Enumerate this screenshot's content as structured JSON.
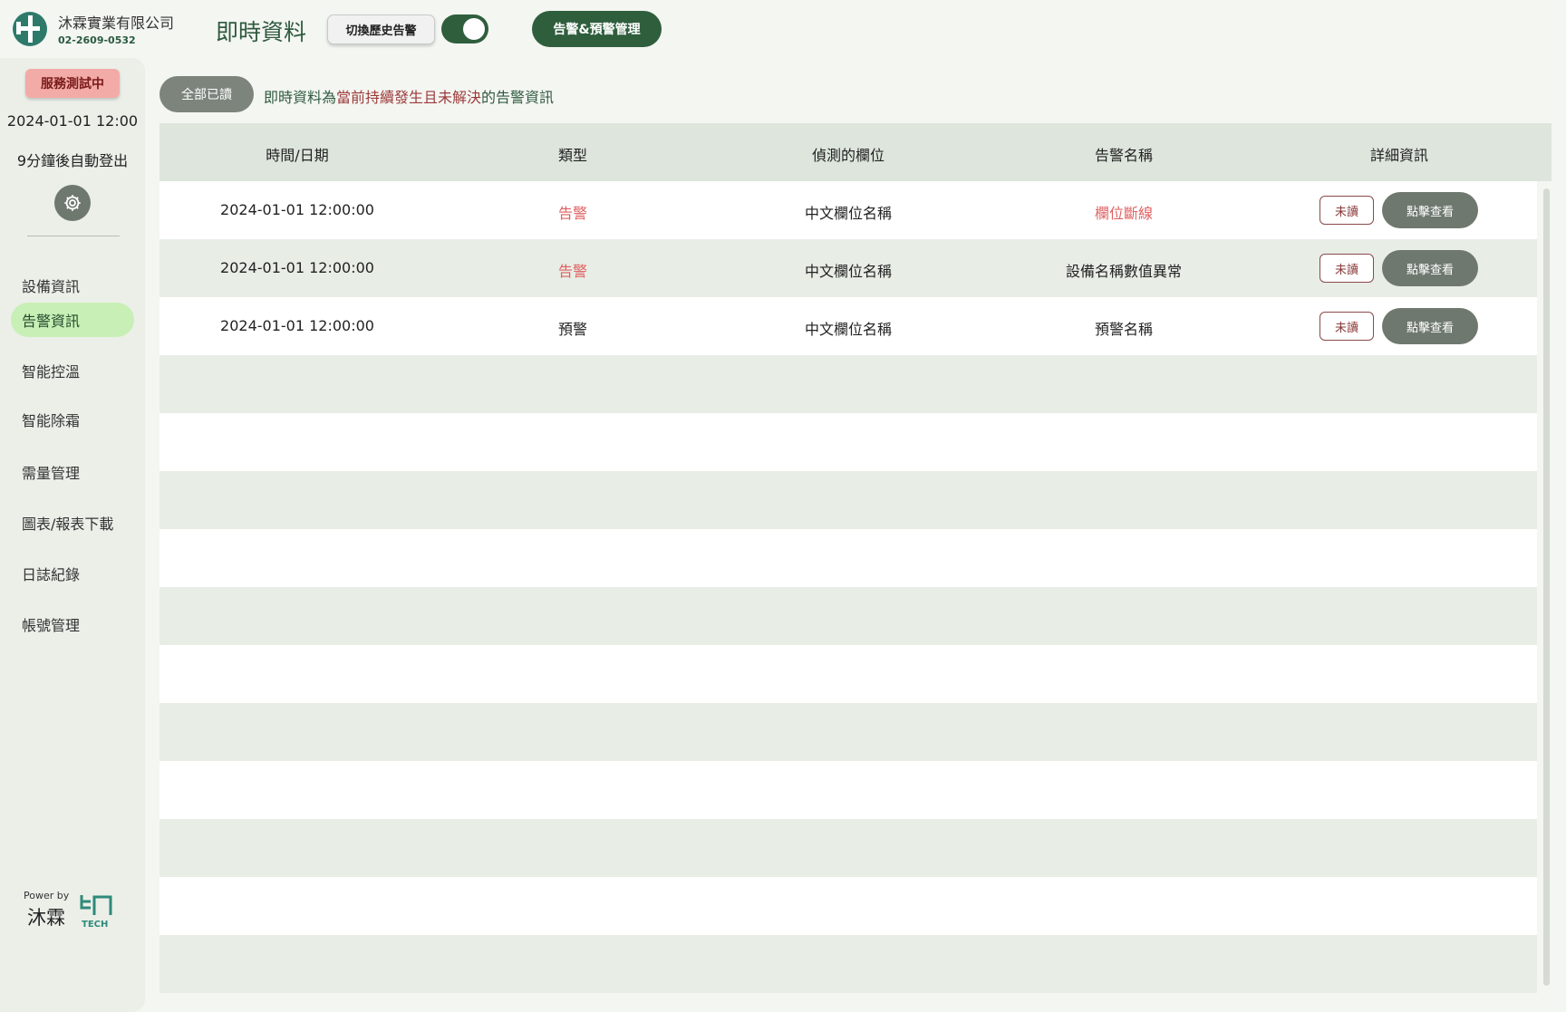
{
  "header": {
    "company": "沐霖實業有限公司",
    "phone": "02-2609-0532",
    "title": "即時資料",
    "history_toggle_label": "切換歷史告警",
    "management_button": "告警&預警管理"
  },
  "sidebar": {
    "status_badge": "服務測試中",
    "clock": "2024-01-01 12:00",
    "auto_logout": "9分鐘後自動登出",
    "items": [
      {
        "label": "設備資訊",
        "active": false
      },
      {
        "label": "告警資訊",
        "active": true
      },
      {
        "label": "智能控溫",
        "active": false
      },
      {
        "label": "智能除霜",
        "active": false
      },
      {
        "label": "需量管理",
        "active": false
      },
      {
        "label": "圖表/報表下載",
        "active": false
      },
      {
        "label": "日誌紀錄",
        "active": false
      },
      {
        "label": "帳號管理",
        "active": false
      }
    ],
    "powered_by": "Power by",
    "brand": "沐霖",
    "tech_label": "TECH"
  },
  "toolbar": {
    "mark_all_read": "全部已讀",
    "note_prefix": "即時資料為",
    "note_highlight": "當前持續發生且未解決",
    "note_suffix": "的告警資訊"
  },
  "table": {
    "columns": [
      "時間/日期",
      "類型",
      "偵測的欄位",
      "告警名稱",
      "詳細資訊"
    ],
    "rows": [
      {
        "datetime": "2024-01-01 12:00:00",
        "type": "告警",
        "field": "中文欄位名稱",
        "alarm_name": "欄位斷線",
        "status": "未讀",
        "action": "點擊查看"
      },
      {
        "datetime": "2024-01-01 12:00:00",
        "type": "告警",
        "field": "中文欄位名稱",
        "alarm_name": "設備名稱數值異常",
        "status": "未讀",
        "action": "點擊查看"
      },
      {
        "datetime": "2024-01-01 12:00:00",
        "type": "預警",
        "field": "中文欄位名稱",
        "alarm_name": "預警名稱",
        "status": "未讀",
        "action": "點擊查看"
      }
    ]
  },
  "colors": {
    "primary": "#2f5e3d",
    "alarm_red": "#e06060",
    "active_nav": "#c8efb5",
    "badge": "#f2aba6"
  }
}
